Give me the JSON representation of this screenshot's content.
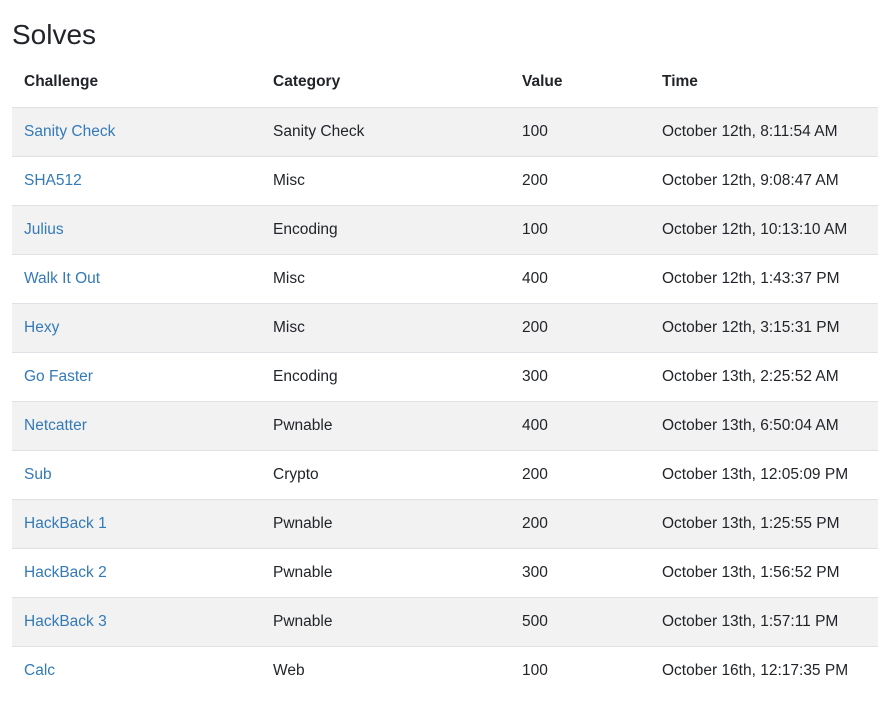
{
  "title": "Solves",
  "columns": [
    "Challenge",
    "Category",
    "Value",
    "Time"
  ],
  "rows": [
    {
      "challenge": "Sanity Check",
      "category": "Sanity Check",
      "value": "100",
      "time": "October 12th, 8:11:54 AM"
    },
    {
      "challenge": "SHA512",
      "category": "Misc",
      "value": "200",
      "time": "October 12th, 9:08:47 AM"
    },
    {
      "challenge": "Julius",
      "category": "Encoding",
      "value": "100",
      "time": "October 12th, 10:13:10 AM"
    },
    {
      "challenge": "Walk It Out",
      "category": "Misc",
      "value": "400",
      "time": "October 12th, 1:43:37 PM"
    },
    {
      "challenge": "Hexy",
      "category": "Misc",
      "value": "200",
      "time": "October 12th, 3:15:31 PM"
    },
    {
      "challenge": "Go Faster",
      "category": "Encoding",
      "value": "300",
      "time": "October 13th, 2:25:52 AM"
    },
    {
      "challenge": "Netcatter",
      "category": "Pwnable",
      "value": "400",
      "time": "October 13th, 6:50:04 AM"
    },
    {
      "challenge": "Sub",
      "category": "Crypto",
      "value": "200",
      "time": "October 13th, 12:05:09 PM"
    },
    {
      "challenge": "HackBack 1",
      "category": "Pwnable",
      "value": "200",
      "time": "October 13th, 1:25:55 PM"
    },
    {
      "challenge": "HackBack 2",
      "category": "Pwnable",
      "value": "300",
      "time": "October 13th, 1:56:52 PM"
    },
    {
      "challenge": "HackBack 3",
      "category": "Pwnable",
      "value": "500",
      "time": "October 13th, 1:57:11 PM"
    },
    {
      "challenge": "Calc",
      "category": "Web",
      "value": "100",
      "time": "October 16th, 12:17:35 PM"
    }
  ],
  "colors": {
    "link": "#337ab7",
    "stripe": "#f2f2f2",
    "border": "#dee2e6",
    "text": "#212529"
  }
}
